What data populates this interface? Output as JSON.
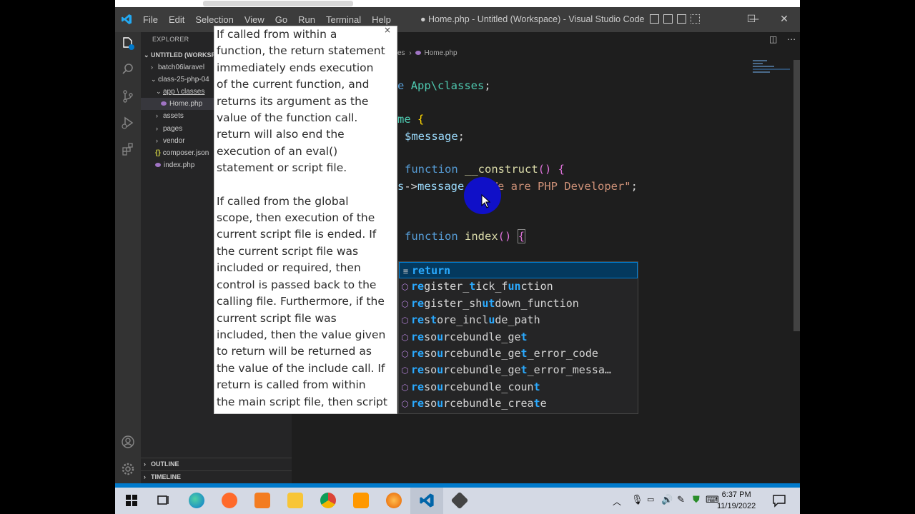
{
  "window": {
    "title": "● Home.php - Untitled (Workspace) - Visual Studio Code",
    "menu": [
      "File",
      "Edit",
      "Selection",
      "View",
      "Go",
      "Run",
      "Terminal",
      "Help"
    ],
    "minimize": "—",
    "maximize": "☐",
    "close": "✕"
  },
  "sidebar": {
    "header": "EXPLORER",
    "workspace": "UNTITLED (WORKSP...",
    "tree": [
      {
        "label": "batch06laravel",
        "kind": "folder",
        "open": false
      },
      {
        "label": "class-25-php-04",
        "kind": "folder",
        "open": true
      },
      {
        "label": "app \\ classes",
        "kind": "folder",
        "open": true
      },
      {
        "label": "Home.php",
        "kind": "php",
        "selected": true
      },
      {
        "label": "assets",
        "kind": "folder",
        "open": false
      },
      {
        "label": "pages",
        "kind": "folder",
        "open": false
      },
      {
        "label": "vendor",
        "kind": "folder",
        "open": false
      },
      {
        "label": "composer.json",
        "kind": "json"
      },
      {
        "label": "index.php",
        "kind": "php"
      }
    ],
    "outline": "OUTLINE",
    "timeline": "TIMELINE"
  },
  "editor": {
    "breadcrumb_tail": "es",
    "breadcrumb_sep": "›",
    "breadcrumb_file": "Home.php",
    "lines": {
      "l1_kw": "e",
      "l1_ns": "App\\classes",
      "l1_end": ";",
      "l2_kw": "me",
      "l2_brace": "{",
      "l3_var": "$message",
      "l3_end": ";",
      "l4_kw": "function",
      "l4_fn": "__construct",
      "l4_par": "()",
      "l4_brace": "{",
      "l5_var": "s",
      "l5_arrow": "->",
      "l5_prop": "message",
      "l5_eq": " = ",
      "l5_str": "\"We are PHP Developer\"",
      "l5_end": ";",
      "l6_kw": "function",
      "l6_fn": "index",
      "l6_par": "()",
      "l6_brace": "{"
    }
  },
  "hover": {
    "close": "×",
    "para1": [
      "If called from within a",
      "function, the return statement",
      "immediately ends execution",
      "of the current function, and",
      "returns its argument as the",
      "value of the function call.",
      "return will also end the",
      "execution of an eval()",
      "statement or script file."
    ],
    "para2": [
      "If called from the global",
      "scope, then execution of the",
      "current script file is ended. If",
      "the current script file was",
      "included or required, then",
      "control is passed back to the",
      "calling file. Furthermore, if the",
      "current script file was",
      "included, then the value given",
      "to return will be returned as",
      "the value of the include call. If",
      "return is called from within",
      "the main script file, then script"
    ]
  },
  "suggestions": [
    {
      "parts": [
        [
          "ret",
          true
        ],
        [
          "urn",
          true
        ]
      ],
      "icon": "keyword"
    },
    {
      "parts": [
        [
          "re",
          true
        ],
        [
          "gister_",
          false
        ],
        [
          "t",
          true
        ],
        [
          "ick_f",
          false
        ],
        [
          "un",
          true
        ],
        [
          "ction",
          false
        ]
      ],
      "icon": "method"
    },
    {
      "parts": [
        [
          "re",
          true
        ],
        [
          "gister_sh",
          false
        ],
        [
          "ut",
          true
        ],
        [
          "down_function",
          false
        ]
      ],
      "icon": "method"
    },
    {
      "parts": [
        [
          "re",
          true
        ],
        [
          "s",
          false
        ],
        [
          "t",
          true
        ],
        [
          "ore_incl",
          false
        ],
        [
          "u",
          true
        ],
        [
          "de_path",
          false
        ]
      ],
      "icon": "method"
    },
    {
      "parts": [
        [
          "re",
          true
        ],
        [
          "so",
          false
        ],
        [
          "u",
          true
        ],
        [
          "rcebundle_ge",
          false
        ],
        [
          "t",
          true
        ]
      ],
      "icon": "method"
    },
    {
      "parts": [
        [
          "re",
          true
        ],
        [
          "so",
          false
        ],
        [
          "u",
          true
        ],
        [
          "rcebundle_ge",
          false
        ],
        [
          "t",
          true
        ],
        [
          "_error_code",
          false
        ]
      ],
      "icon": "method"
    },
    {
      "parts": [
        [
          "re",
          true
        ],
        [
          "so",
          false
        ],
        [
          "u",
          true
        ],
        [
          "rcebundle_ge",
          false
        ],
        [
          "t",
          true
        ],
        [
          "_error_messa…",
          false
        ]
      ],
      "icon": "method"
    },
    {
      "parts": [
        [
          "re",
          true
        ],
        [
          "so",
          false
        ],
        [
          "u",
          true
        ],
        [
          "rcebundle_coun",
          false
        ],
        [
          "t",
          true
        ]
      ],
      "icon": "method"
    },
    {
      "parts": [
        [
          "re",
          true
        ],
        [
          "so",
          false
        ],
        [
          "u",
          true
        ],
        [
          "rcebundle_crea",
          false
        ],
        [
          "t",
          true
        ],
        [
          "e",
          false
        ]
      ],
      "icon": "method"
    }
  ],
  "taskbar": {
    "time": "6:37 PM",
    "date": "11/19/2022"
  },
  "colors": {
    "accent": "#007acc",
    "match": "#2aaaff",
    "editor_bg": "#1e1e1e"
  }
}
